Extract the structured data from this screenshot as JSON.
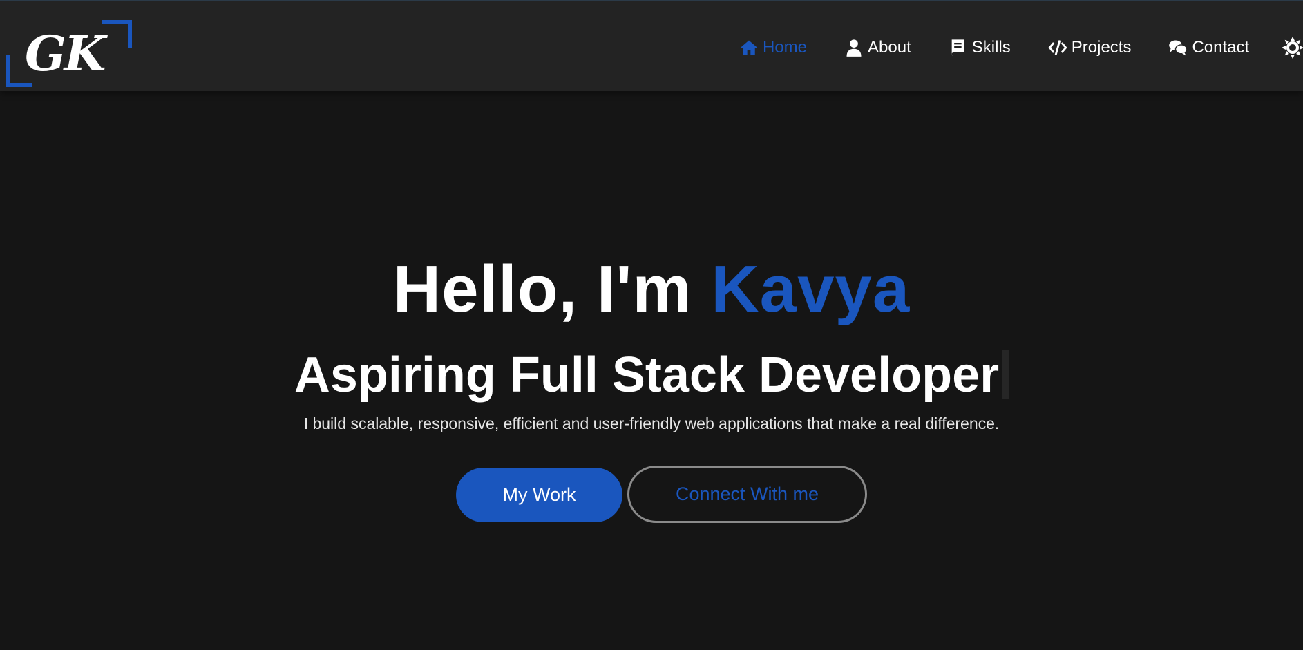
{
  "brand": {
    "logo_text": "GK",
    "accent_color": "#1a56be"
  },
  "nav": {
    "items": [
      {
        "label": "Home",
        "icon": "home-icon",
        "active": true
      },
      {
        "label": "About",
        "icon": "user-icon",
        "active": false
      },
      {
        "label": "Skills",
        "icon": "book-icon",
        "active": false
      },
      {
        "label": "Projects",
        "icon": "code-icon",
        "active": false
      },
      {
        "label": "Contact",
        "icon": "comments-icon",
        "active": false
      }
    ],
    "theme_toggle_icon": "sun-icon"
  },
  "hero": {
    "greeting": "Hello, I'm ",
    "name": "Kavya",
    "role": "Aspiring Full Stack Developer",
    "tagline": "I build scalable, responsive, efficient and user-friendly web applications that make a real difference.",
    "primary_button": "My Work",
    "secondary_button": "Connect With me"
  },
  "colors": {
    "background": "#151515",
    "navbar": "#232323",
    "accent": "#1a56be",
    "text": "#ffffff"
  }
}
